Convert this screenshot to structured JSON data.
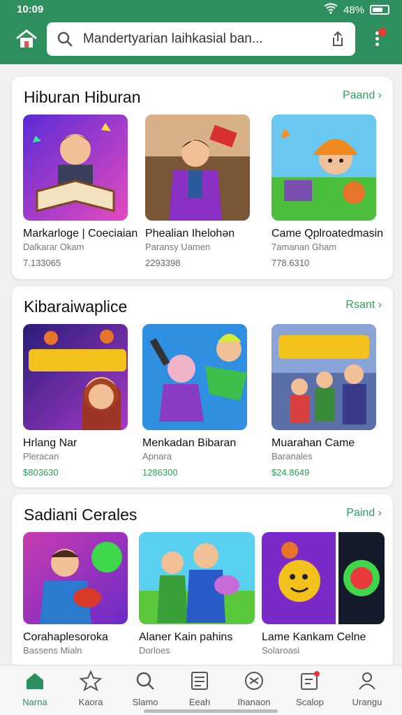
{
  "status": {
    "time": "10:09",
    "battery": "48%"
  },
  "search": {
    "text": "Mandertyarian laihkasial ban..."
  },
  "sections": [
    {
      "title": "Hiburan Hiburan",
      "more": "Paand",
      "items": [
        {
          "name": "Markarloge | Coeciaian",
          "sub": "Dalkarar Okam",
          "num": "7.133065"
        },
        {
          "name": "Phealian Ihelohǝn",
          "sub": "Paransy Uamen",
          "num": "2293398"
        },
        {
          "name": "Came Qplroatedmasin",
          "sub": "7amanan Gham",
          "num": "778.6310"
        }
      ]
    },
    {
      "title": "Kibaraiwaplice",
      "more": "Rsant",
      "items": [
        {
          "name": "Hrlang Nar",
          "sub": "Pleracan",
          "num": "$803630"
        },
        {
          "name": "Menkadan Bibaran",
          "sub": "Apnara",
          "num": "1286300"
        },
        {
          "name": "Muarahan Came",
          "sub": "Baranales",
          "num": "$24.8649"
        }
      ]
    },
    {
      "title": "Sadiani Cerales",
      "more": "Paind",
      "items": [
        {
          "name": "Corahaplesoroka",
          "sub": "Bassens Mialn",
          "num": ""
        },
        {
          "name": "Alaner Kain pahins",
          "sub": "Dorloes",
          "num": ""
        },
        {
          "name": "Lame Kankam Celne",
          "sub": "Solaroasi",
          "num": ""
        }
      ]
    }
  ],
  "nav": [
    {
      "label": "Narna",
      "icon": "home-icon"
    },
    {
      "label": "Kaora",
      "icon": "star-icon"
    },
    {
      "label": "Slamo",
      "icon": "search-icon"
    },
    {
      "label": "Eeah",
      "icon": "list-icon"
    },
    {
      "label": "Ihanaon",
      "icon": "game-icon"
    },
    {
      "label": "Scalop",
      "icon": "notification-icon"
    },
    {
      "label": "Urangu",
      "icon": "profile-icon"
    }
  ]
}
